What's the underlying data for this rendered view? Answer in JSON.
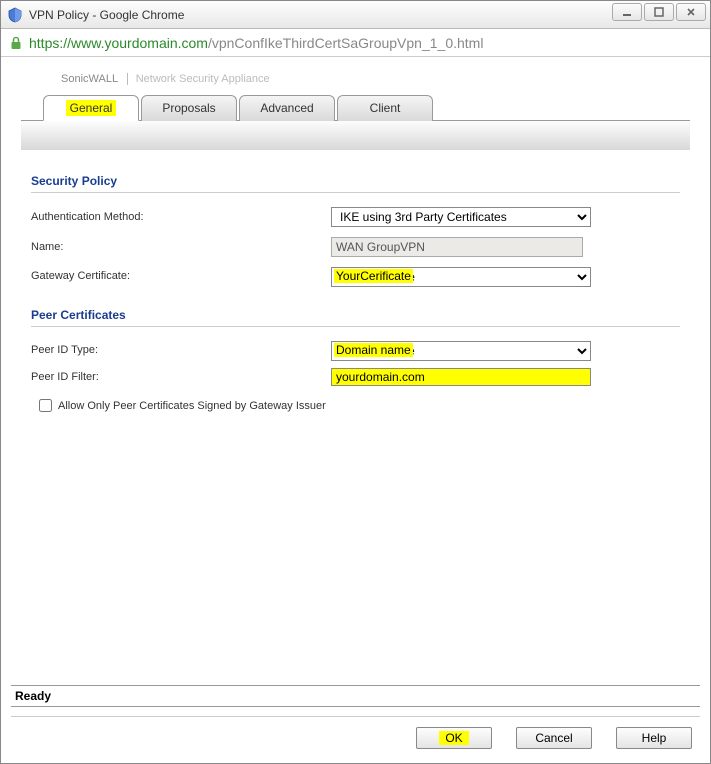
{
  "window": {
    "title": "VPN Policy - Google Chrome"
  },
  "address": {
    "scheme_host": "https://www.yourdomain.com",
    "path": "/vpnConfIkeThirdCertSaGroupVpn_1_0.html"
  },
  "breadcrumb": {
    "brand": "SonicWALL",
    "product": "Network Security Appliance"
  },
  "tabs": [
    {
      "label": "General",
      "active": true
    },
    {
      "label": "Proposals",
      "active": false
    },
    {
      "label": "Advanced",
      "active": false
    },
    {
      "label": "Client",
      "active": false
    }
  ],
  "security_policy": {
    "title": "Security Policy",
    "auth_method_label": "Authentication Method:",
    "auth_method_value": "IKE using 3rd Party Certificates",
    "name_label": "Name:",
    "name_value": "WAN GroupVPN",
    "gateway_cert_label": "Gateway Certificate:",
    "gateway_cert_value": "YourCerificate"
  },
  "peer_certificates": {
    "title": "Peer Certificates",
    "peer_id_type_label": "Peer ID Type:",
    "peer_id_type_value": "Domain name",
    "peer_id_filter_label": "Peer ID Filter:",
    "peer_id_filter_value": "yourdomain.com",
    "allow_only_label": "Allow Only Peer Certificates Signed by Gateway Issuer",
    "allow_only_checked": false
  },
  "status": {
    "text": "Ready"
  },
  "buttons": {
    "ok": "OK",
    "cancel": "Cancel",
    "help": "Help"
  }
}
